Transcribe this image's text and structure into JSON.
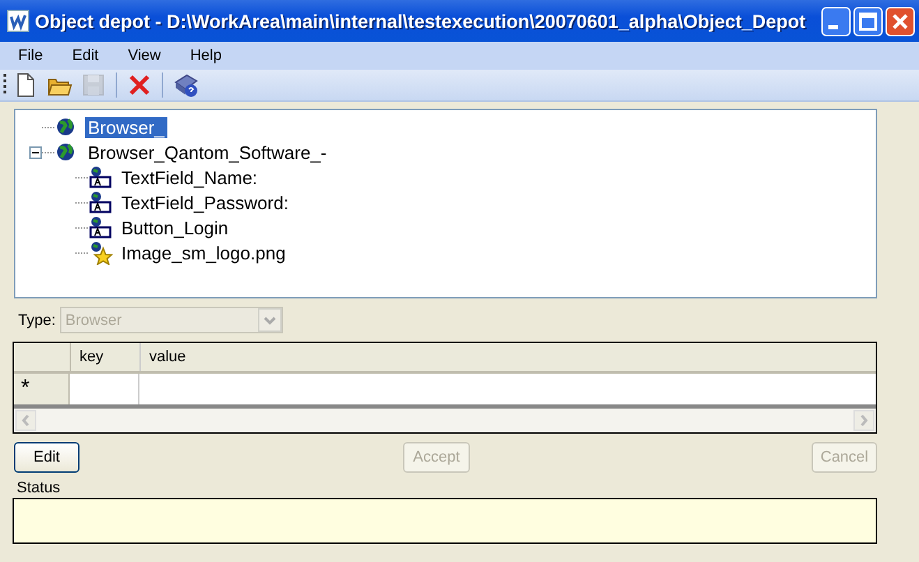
{
  "window": {
    "title": "Object depot - D:\\WorkArea\\main\\internal\\testexecution\\20070601_alpha\\Object_Depot"
  },
  "menu": [
    "File",
    "Edit",
    "View",
    "Help"
  ],
  "toolbar": [
    {
      "kind": "new",
      "disabled": false
    },
    {
      "kind": "open",
      "disabled": false
    },
    {
      "kind": "save",
      "disabled": true
    },
    {
      "kind": "sep"
    },
    {
      "kind": "delete",
      "disabled": false
    },
    {
      "kind": "sep"
    },
    {
      "kind": "help",
      "disabled": false
    }
  ],
  "tree": [
    {
      "label": "Browser_",
      "kind": "globe",
      "selected": true
    },
    {
      "label": "Browser_Qantom_Software_-",
      "kind": "globe",
      "selected": false,
      "expanded": true,
      "children": [
        {
          "label": "TextField_Name:",
          "kind": "field",
          "selected": false
        },
        {
          "label": "TextField_Password:",
          "kind": "field",
          "selected": false
        },
        {
          "label": "Button_Login",
          "kind": "field",
          "selected": false
        },
        {
          "label": "Image_sm_logo.png",
          "kind": "image",
          "selected": false
        }
      ]
    }
  ],
  "type": {
    "label": "Type:",
    "value": "Browser",
    "disabled": true
  },
  "grid": {
    "columns": [
      "key",
      "value"
    ],
    "new_row_marker": "*"
  },
  "buttons": [
    {
      "label": "Edit",
      "disabled": false
    },
    {
      "label": "Accept",
      "disabled": true
    },
    {
      "label": "Cancel",
      "disabled": true
    }
  ],
  "status": {
    "label": "Status"
  }
}
